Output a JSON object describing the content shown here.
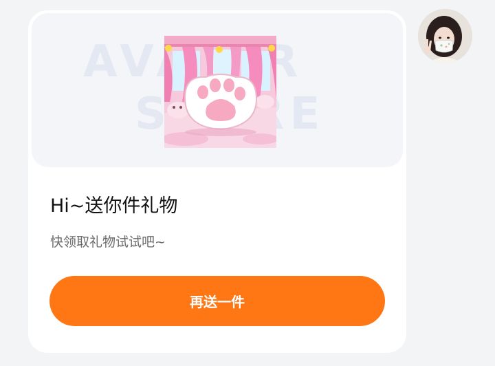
{
  "message": {
    "gift_card": {
      "preview": {
        "watermark_line1": "AVATAR",
        "watermark_line2": "STORE",
        "image_icon": "cat-paw-cushion-image"
      },
      "title": "Hi~送你件礼物",
      "subtitle": "快领取礼物试试吧~",
      "button_label": "再送一件"
    },
    "sender": {
      "avatar_icon": "user-avatar-photo"
    }
  },
  "colors": {
    "background": "#f3f4f6",
    "card": "#ffffff",
    "preview_bg": "#f3f5f9",
    "accent": "#ff7614",
    "title_text": "#111111",
    "subtitle_text": "#6b6b6b"
  }
}
